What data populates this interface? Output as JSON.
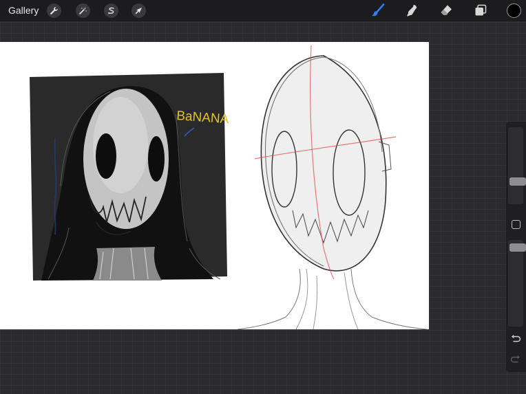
{
  "topbar": {
    "gallery_label": "Gallery",
    "left_tools": [
      "wrench-icon",
      "magic-wand-icon",
      "selection-icon",
      "transform-arrow-icon"
    ],
    "right_tools": [
      "brush-icon",
      "smudge-icon",
      "eraser-icon",
      "layers-icon"
    ],
    "active_tool": "brush",
    "accent_color": "#2f7df6",
    "current_color": "#000000"
  },
  "canvas": {
    "background": "#ffffff",
    "artwork_text": "BaNANA"
  },
  "sidebar": {
    "brush_size": 0.27,
    "opacity": 0.96,
    "controls": [
      "brush-size-slider",
      "modify-button",
      "opacity-slider",
      "undo-icon",
      "redo-icon"
    ]
  }
}
